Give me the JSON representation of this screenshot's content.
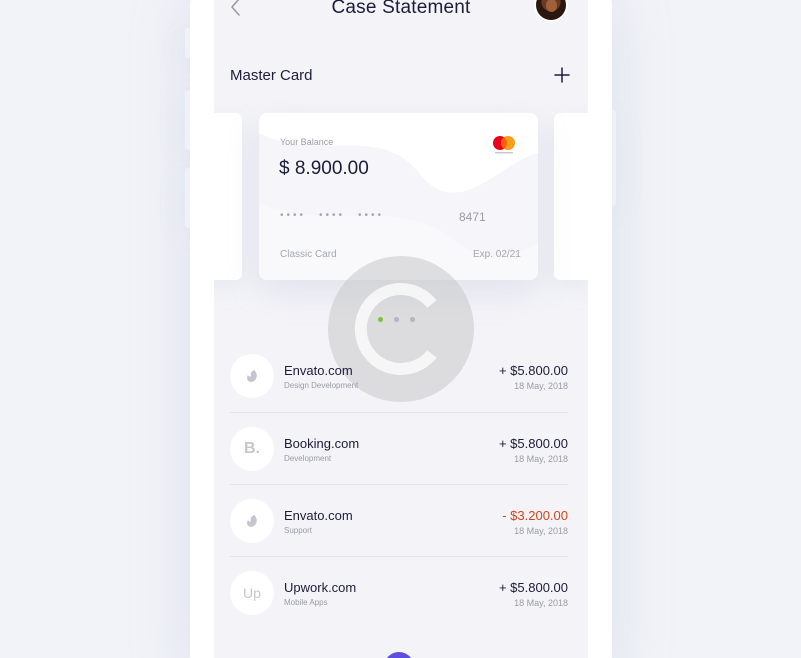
{
  "header": {
    "title": "Case Statement"
  },
  "section": {
    "label": "Master Card"
  },
  "card": {
    "balance_label": "Your Balance",
    "balance": "$ 8.900.00",
    "masked_groups": [
      "••••",
      "••••",
      "••••"
    ],
    "last4": "8471",
    "type": "Classic Card",
    "expiry": "Exp. 02/21",
    "brand_icon": "mastercard-logo"
  },
  "pager": {
    "count": 3,
    "active": 0,
    "active_color": "#7cc142",
    "inactive_color": "#b5b5c8"
  },
  "transactions": [
    {
      "icon": "envato-icon",
      "name": "Envato.com",
      "category": "Design Development",
      "amount": "+ $5.800.00",
      "date": "18 May, 2018",
      "type": "credit"
    },
    {
      "icon": "booking-icon",
      "icon_text": "B.",
      "name": "Booking.com",
      "category": "Development",
      "amount": "+ $5.800.00",
      "date": "18 May, 2018",
      "type": "credit"
    },
    {
      "icon": "envato-icon",
      "name": "Envato.com",
      "category": "Support",
      "amount": "- $3.200.00",
      "date": "18 May, 2018",
      "type": "debit"
    },
    {
      "icon": "upwork-icon",
      "icon_text": "Up",
      "name": "Upwork.com",
      "category": "Mobile Apps",
      "amount": "+ $5.800.00",
      "date": "18 May, 2018",
      "type": "credit"
    }
  ],
  "colors": {
    "accent": "#5b4ee0",
    "negative": "#d0451b",
    "text": "#1c1c3a",
    "muted": "#9a9aa8"
  }
}
